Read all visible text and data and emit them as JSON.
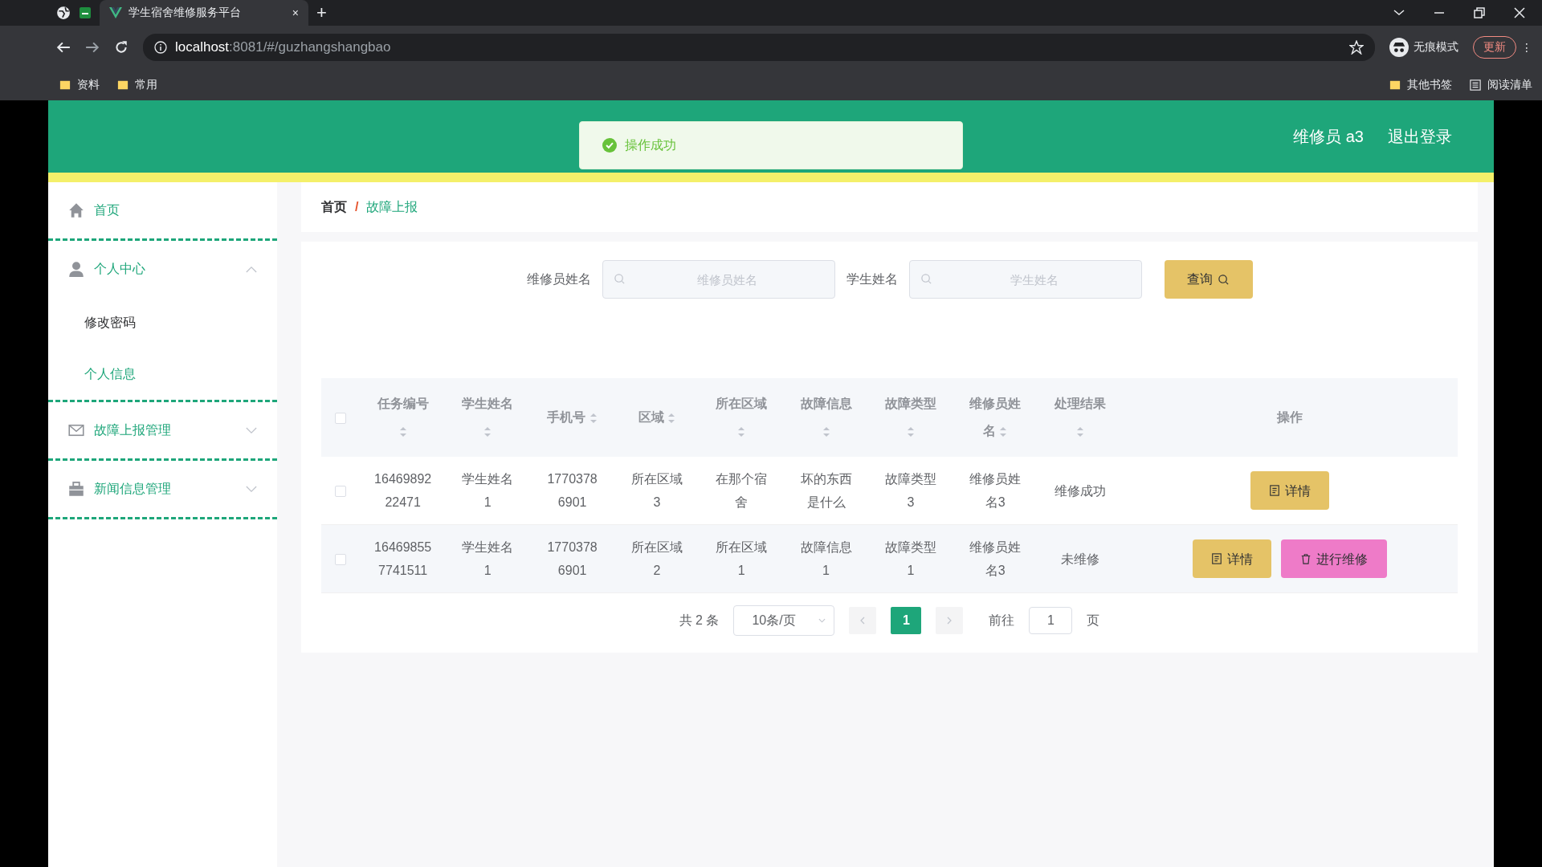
{
  "browser": {
    "tabs": [
      {
        "title": "学生宿舍维修服务平台",
        "close": "×",
        "selected": true
      }
    ],
    "new_tab": "+",
    "url_host": "localhost",
    "url_rest": ":8081/#/guzhangshangbao",
    "incognito": "无痕模式",
    "update_button": "更新",
    "menu_button": "⋮",
    "bookmarks": [
      "资料",
      "常用"
    ],
    "right_bookmarks": [
      {
        "label": "其他书签",
        "kind": "folder"
      },
      {
        "label": "阅读清单",
        "kind": "list"
      }
    ]
  },
  "header": {
    "user": "维修员 a3",
    "logout": "退出登录",
    "toast": {
      "kind": "success",
      "message": "操作成功"
    }
  },
  "sidebar": {
    "items": [
      {
        "label": "首页"
      },
      {
        "label": "个人中心",
        "expanded": true,
        "children": [
          {
            "label": "修改密码",
            "selected": true
          },
          {
            "label": "个人信息",
            "selected": false
          }
        ]
      },
      {
        "label": "故障上报管理",
        "expanded": false
      },
      {
        "label": "新闻信息管理",
        "expanded": false
      }
    ]
  },
  "breadcrumb": {
    "separator": "/",
    "items": [
      {
        "label": "首页",
        "selected": false
      },
      {
        "label": "故障上报",
        "selected": true
      }
    ]
  },
  "search": {
    "fields": [
      {
        "label": "维修员姓名",
        "placeholder": "维修员姓名"
      },
      {
        "label": "学生姓名",
        "placeholder": "学生姓名"
      }
    ],
    "button": "查询"
  },
  "table": {
    "select_all_checked": false,
    "columns": [
      {
        "label": "任务编号",
        "sortable": true
      },
      {
        "label": "学生姓名",
        "sortable": true
      },
      {
        "label": "手机号",
        "sortable": true
      },
      {
        "label": "区域",
        "sortable": true
      },
      {
        "label": "所在区域",
        "sortable": true
      },
      {
        "label": "故障信息",
        "sortable": true
      },
      {
        "label": "故障类型",
        "sortable": true
      },
      {
        "label": "维修员姓名",
        "sortable": true
      },
      {
        "label": "处理结果",
        "sortable": true
      },
      {
        "label": "操作",
        "sortable": false
      }
    ],
    "rows": [
      {
        "checked": false,
        "cells": [
          "1646989222471",
          "学生姓名1",
          "17703786901",
          "所在区域3",
          "在那个宿舍",
          "坏的东西是什么",
          "故障类型3",
          "维修员姓名3",
          "维修成功"
        ],
        "actions": [
          {
            "label": "详情",
            "kind": "detail"
          }
        ]
      },
      {
        "checked": false,
        "cells": [
          "164698557741511",
          "学生姓名1",
          "17703786901",
          "所在区域2",
          "所在区域1",
          "故障信息1",
          "故障类型1",
          "维修员姓名3",
          "未维修"
        ],
        "actions": [
          {
            "label": "详情",
            "kind": "detail"
          },
          {
            "label": "进行维修",
            "kind": "repair"
          }
        ]
      }
    ]
  },
  "pagination": {
    "total": "共 2 条",
    "page_size": "10条/页",
    "pages": [
      {
        "label": "1",
        "selected": true
      }
    ],
    "goto_label": "前往",
    "goto_value": "1",
    "goto_suffix": "页"
  }
}
